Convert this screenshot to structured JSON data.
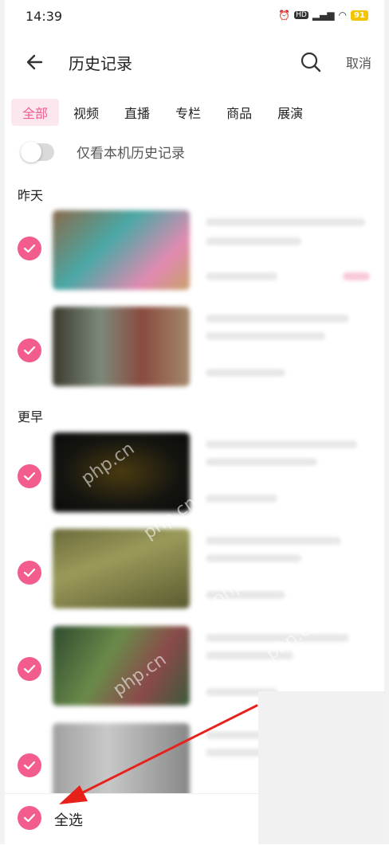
{
  "status_bar": {
    "time": "14:39",
    "icons": [
      "alarm-icon",
      "hd-icon",
      "5g-signal-icon",
      "wifi-icon"
    ],
    "battery": "91"
  },
  "header": {
    "title": "历史记录",
    "cancel_label": "取消"
  },
  "tabs": [
    {
      "label": "全部",
      "active": true
    },
    {
      "label": "视频",
      "active": false
    },
    {
      "label": "直播",
      "active": false
    },
    {
      "label": "专栏",
      "active": false
    },
    {
      "label": "商品",
      "active": false
    },
    {
      "label": "展演",
      "active": false
    }
  ],
  "local_only_toggle": {
    "label": "仅看本机历史记录",
    "on": false
  },
  "sections": [
    {
      "label": "昨天"
    },
    {
      "label": "更早"
    }
  ],
  "bottom_bar": {
    "select_all_label": "全选"
  },
  "watermark": "php.cn",
  "colors": {
    "accent": "#f25d8e",
    "tab_active_bg": "#fde7ee",
    "toggle_off": "#dadada",
    "annotation_arrow": "#e8201a"
  }
}
